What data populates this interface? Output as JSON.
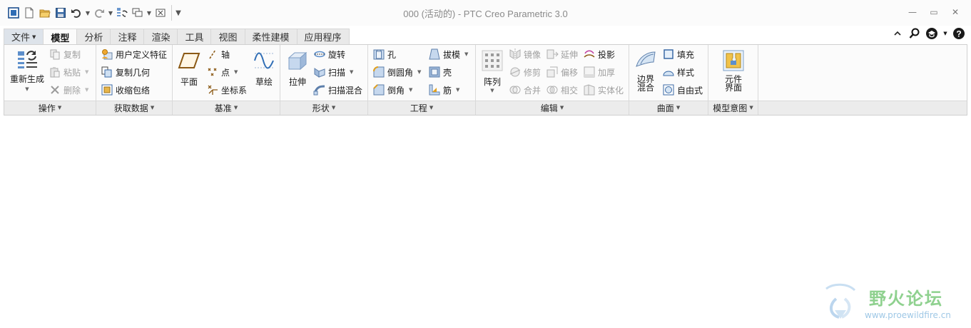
{
  "window": {
    "title": "000 (活动的) - PTC Creo Parametric 3.0"
  },
  "tabs": [
    "文件",
    "模型",
    "分析",
    "注释",
    "渲染",
    "工具",
    "视图",
    "柔性建模",
    "应用程序"
  ],
  "ribbon": {
    "operations": {
      "title": "操作",
      "regenerate": "重新生成",
      "copy": "复制",
      "paste": "粘贴",
      "delete": "删除"
    },
    "get_data": {
      "title": "获取数据",
      "udf": "用户定义特征",
      "copy_geometry": "复制几何",
      "shrinkwrap": "收缩包络"
    },
    "datum": {
      "title": "基准",
      "plane": "平面",
      "axis": "轴",
      "point": "点",
      "csys": "坐标系",
      "sketch": "草绘"
    },
    "shapes": {
      "title": "形状",
      "extrude": "拉伸",
      "revolve": "旋转",
      "sweep": "扫描",
      "swept_blend": "扫描混合"
    },
    "engineering": {
      "title": "工程",
      "hole": "孔",
      "round": "倒圆角",
      "chamfer": "倒角",
      "draft": "拔模",
      "shell": "壳",
      "rib": "筋"
    },
    "editing": {
      "title": "编辑",
      "pattern": "阵列",
      "mirror": "镜像",
      "extend": "延伸",
      "project": "投影",
      "trim": "修剪",
      "offset": "偏移",
      "thicken": "加厚",
      "merge": "合并",
      "intersect": "相交",
      "solidify": "实体化"
    },
    "surfaces": {
      "title": "曲面",
      "boundary_blend_1": "边界",
      "boundary_blend_2": "混合",
      "fill": "填充",
      "style": "样式",
      "freestyle": "自由式"
    },
    "model_intent": {
      "title": "模型意图",
      "component_interface_1": "元件",
      "component_interface_2": "界面"
    }
  },
  "watermark": {
    "name": "野火论坛",
    "url": "www.proewildfire.cn"
  },
  "colors": {
    "accent_blue": "#2f6db5",
    "tab_bg": "#e9e9e9",
    "ribbon_bg": "#fbfbfb",
    "group_bar": "#ececec"
  }
}
